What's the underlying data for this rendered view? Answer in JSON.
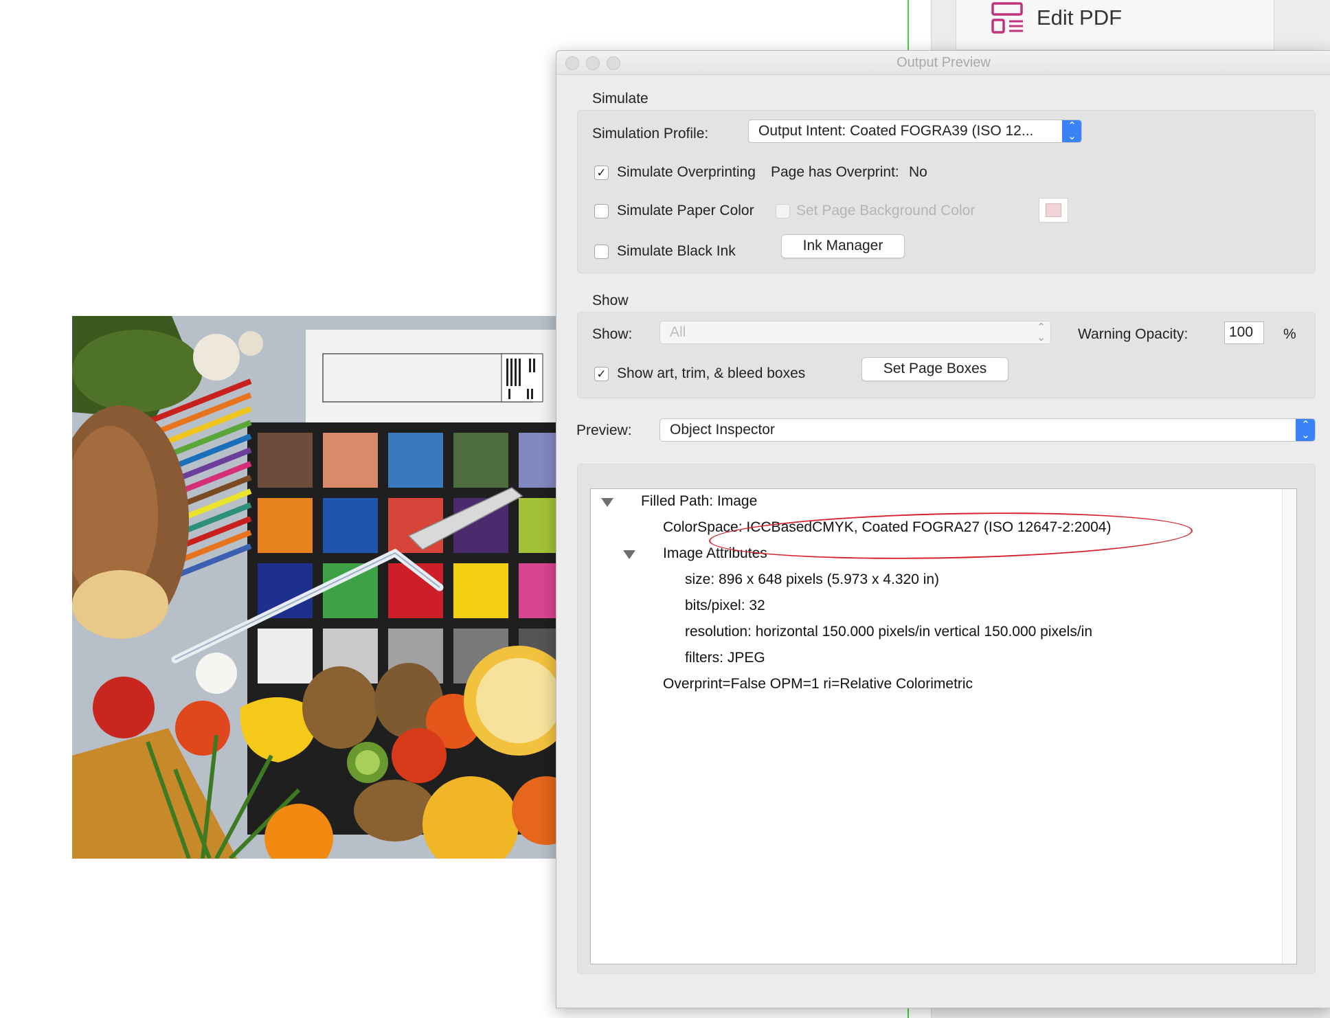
{
  "app": {
    "tool_label": "Edit PDF",
    "tool_icon": "edit-pdf-icon"
  },
  "dialog": {
    "title": "Output Preview",
    "simulate": {
      "section": "Simulate",
      "profile_label": "Simulation Profile:",
      "profile_value": "Output Intent: Coated FOGRA39 (ISO 12...",
      "simulate_overprinting": "Simulate Overprinting",
      "simulate_overprinting_checked": true,
      "page_has_overprint_label": "Page has Overprint:",
      "page_has_overprint_value": "No",
      "simulate_paper_color": "Simulate Paper Color",
      "simulate_paper_color_checked": false,
      "set_page_background_color": "Set Page Background Color",
      "set_page_background_color_checked": false,
      "background_swatch_color": "#f0d4d7",
      "simulate_black_ink": "Simulate Black Ink",
      "simulate_black_ink_checked": false,
      "ink_manager": "Ink Manager"
    },
    "show": {
      "section": "Show",
      "show_label": "Show:",
      "show_value": "All",
      "warning_opacity_label": "Warning Opacity:",
      "warning_opacity_value": "100",
      "percent": "%",
      "show_boxes": "Show art, trim, & bleed boxes",
      "show_boxes_checked": true,
      "set_page_boxes": "Set Page Boxes"
    },
    "preview": {
      "label": "Preview:",
      "value": "Object Inspector"
    },
    "inspector": {
      "filled_path": "Filled Path: Image",
      "colorspace": "ColorSpace: ICCBasedCMYK, Coated FOGRA27 (ISO 12647-2:2004)",
      "image_attributes": "Image Attributes",
      "size": "size: 896 x 648 pixels (5.973 x 4.320 in)",
      "bits": "bits/pixel: 32",
      "resolution": "resolution: horizontal 150.000 pixels/in vertical 150.000 pixels/in",
      "filters": "filters: JPEG",
      "overprint": "Overprint=False OPM=1 ri=Relative Colorimetric"
    }
  },
  "colors": {
    "accent": "#3b82f6",
    "guide": "#3fd13a",
    "annotation": "#d8202a",
    "tool_icon": "#c2337f"
  }
}
